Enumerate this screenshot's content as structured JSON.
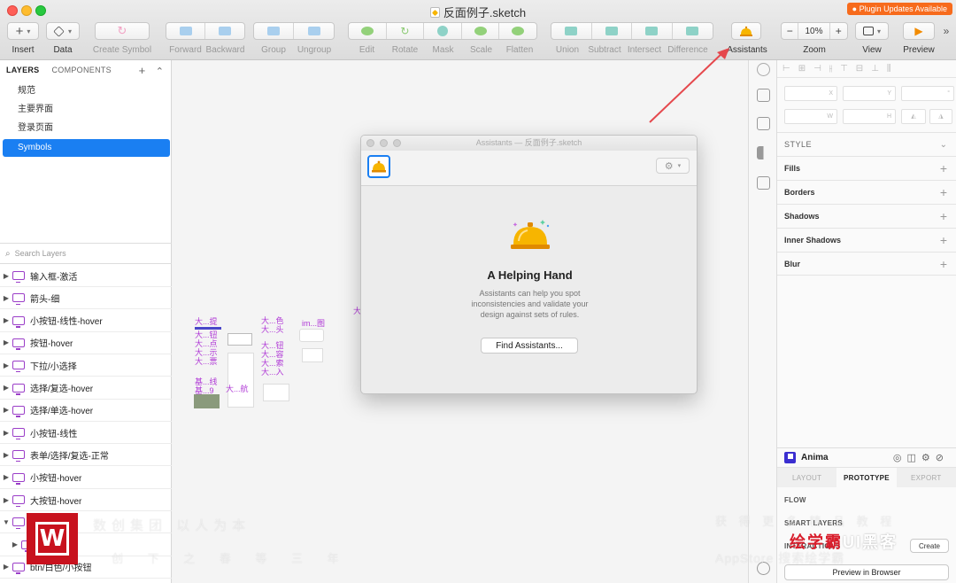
{
  "window": {
    "title": "反面例子.sketch",
    "plugin_badge": "Plugin Updates Available"
  },
  "toolbar": {
    "insert": "Insert",
    "data": "Data",
    "create_symbol": "Create Symbol",
    "forward": "Forward",
    "backward": "Backward",
    "group": "Group",
    "ungroup": "Ungroup",
    "edit": "Edit",
    "rotate": "Rotate",
    "mask": "Mask",
    "scale": "Scale",
    "flatten": "Flatten",
    "union": "Union",
    "subtract": "Subtract",
    "intersect": "Intersect",
    "difference": "Difference",
    "assistants": "Assistants",
    "zoom": "Zoom",
    "zoom_value": "10%",
    "zoom_minus": "−",
    "zoom_plus": "+",
    "view": "View",
    "preview": "Preview",
    "insert_plus": "+",
    "more": "»"
  },
  "left_panel": {
    "tab_layers": "LAYERS",
    "tab_components": "COMPONENTS",
    "add": "+",
    "collapse": "⌃",
    "pages": [
      "规范",
      "主要界面",
      "登录页面",
      "Symbols"
    ],
    "search_placeholder": "Search Layers",
    "layers": [
      "输入框-激活",
      "箭头-细",
      "小按钮-线性-hover",
      "按钮-hover",
      "下拉/小选择",
      "选择/复选-hover",
      "选择/单选-hover",
      "小按钮-线性",
      "表单/选择/复选-正常",
      "小按钮-hover",
      "大按钮-hover",
      "箭头-蓝色",
      "小箭头",
      "btn/白色/小按钮"
    ]
  },
  "canvas": {
    "labels": [
      "大...提",
      "大...钮",
      "大...点",
      "大...示",
      "大...票",
      "大...色",
      "大...头",
      "大...钮",
      "大...容",
      "大...索",
      "大...入",
      "基...线",
      "基...9",
      "大...航",
      "im...图",
      "大"
    ]
  },
  "dialog": {
    "title": "Assistants — 反面例子.sketch",
    "heading": "A Helping Hand",
    "body": "Assistants can help you spot inconsistencies and validate your design against sets of rules.",
    "button": "Find Assistants..."
  },
  "inspector": {
    "x_label": "X",
    "y_label": "Y",
    "w_label": "W",
    "h_label": "H",
    "style": "STYLE",
    "sections": [
      "Fills",
      "Borders",
      "Shadows",
      "Inner Shadows",
      "Blur"
    ]
  },
  "anima": {
    "title": "Anima",
    "tabs": [
      "LAYOUT",
      "PROTOTYPE",
      "EXPORT"
    ],
    "flow": "FLOW",
    "smart_layers": "SMART LAYERS",
    "interactions": "INTERACTIONS",
    "create": "Create",
    "preview_btn": "Preview in Browser"
  },
  "watermark": {
    "line1": "数创集团 以人为本",
    "line2": "创 下 之 春 等 三 年",
    "right1": "获 得 更 多 精 品 教 程",
    "right2": "AppStore 搜索绘学霸",
    "brand": "绘学霸",
    "brand_ui": "UI黑客",
    "logo_letter": "W"
  },
  "colors": {
    "accent": "#1a7ff2",
    "symbol": "#9b3ec8",
    "plugin_badge": "#f76b1c",
    "arrow": "#e5484d"
  }
}
